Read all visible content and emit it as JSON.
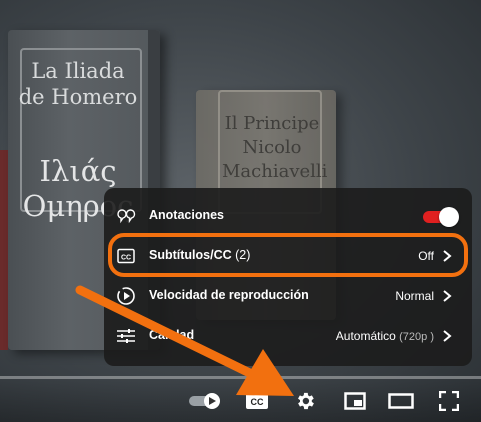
{
  "video": {
    "book1_title_latin": [
      "La Iliada",
      "de Homero"
    ],
    "book1_title_greek": [
      "Ιλιάς",
      "Ομηρος"
    ],
    "book2_title": [
      "Il Principe",
      "Nicolo",
      "Machiavelli"
    ]
  },
  "settings_menu": {
    "annotations": {
      "label": "Anotaciones",
      "icon": "annotations-icon",
      "enabled": true
    },
    "subtitles": {
      "label": "Subtítulos/CC",
      "count": "(2)",
      "value": "Off",
      "icon": "cc-icon"
    },
    "speed": {
      "label": "Velocidad de reproducción",
      "value": "Normal",
      "icon": "playback-speed-icon"
    },
    "quality": {
      "label": "Calidad",
      "value": "Automático",
      "sub_value": "(720p )",
      "icon": "quality-sliders-icon"
    }
  },
  "player_controls": [
    "autoplay-toggle",
    "subtitles-button",
    "settings-button",
    "miniplayer-button",
    "theater-mode-button",
    "fullscreen-button"
  ],
  "colors": {
    "highlight": "#f2700f",
    "toggle_on": "#e02020",
    "menu_bg": "#1c1c1c"
  }
}
